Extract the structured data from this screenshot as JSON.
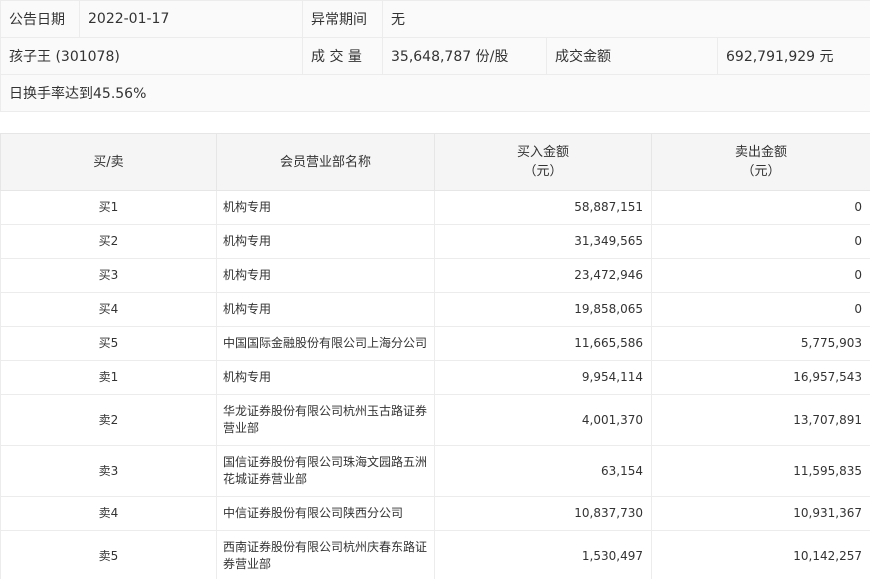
{
  "info": {
    "date_label": "公告日期",
    "date_value": "2022-01-17",
    "period_label": "异常期间",
    "period_value": "无",
    "stock": "孩子王 (301078)",
    "volume_label": "成 交 量",
    "volume_value": "35,648,787 份/股",
    "amount_label": "成交金额",
    "amount_value": "692,791,929 元",
    "reason": "日换手率达到45.56%"
  },
  "table": {
    "headers": {
      "side": "买/卖",
      "name": "会员营业部名称",
      "buy_l1": "买入金额",
      "buy_l2": "（元）",
      "sell_l1": "卖出金额",
      "sell_l2": "（元）"
    },
    "rows": [
      {
        "side": "买1",
        "name": "机构专用",
        "buy": "58,887,151",
        "sell": "0"
      },
      {
        "side": "买2",
        "name": "机构专用",
        "buy": "31,349,565",
        "sell": "0"
      },
      {
        "side": "买3",
        "name": "机构专用",
        "buy": "23,472,946",
        "sell": "0"
      },
      {
        "side": "买4",
        "name": "机构专用",
        "buy": "19,858,065",
        "sell": "0"
      },
      {
        "side": "买5",
        "name": "中国国际金融股份有限公司上海分公司",
        "buy": "11,665,586",
        "sell": "5,775,903"
      },
      {
        "side": "卖1",
        "name": "机构专用",
        "buy": "9,954,114",
        "sell": "16,957,543"
      },
      {
        "side": "卖2",
        "name_l1": "华龙证券股份有限公司杭州玉古路证券",
        "name_l2": "营业部",
        "buy": "4,001,370",
        "sell": "13,707,891"
      },
      {
        "side": "卖3",
        "name_l1": "国信证券股份有限公司珠海文园路五洲",
        "name_l2": "花城证券营业部",
        "buy": "63,154",
        "sell": "11,595,835"
      },
      {
        "side": "卖4",
        "name": "中信证券股份有限公司陕西分公司",
        "buy": "10,837,730",
        "sell": "10,931,367"
      },
      {
        "side": "卖5",
        "name_l1": "西南证券股份有限公司杭州庆春东路证",
        "name_l2": "券营业部",
        "buy": "1,530,497",
        "sell": "10,142,257"
      }
    ]
  }
}
